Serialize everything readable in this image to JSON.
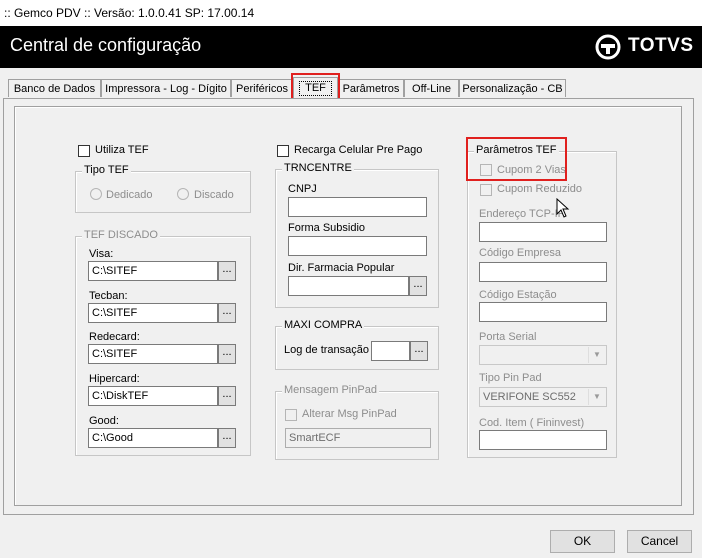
{
  "window": {
    "title": ":: Gemco PDV :: Versão: 1.0.0.41 SP: 17.00.14"
  },
  "header": {
    "title": "Central de configuração",
    "brand": "TOTVS"
  },
  "tabs": [
    {
      "label": "Banco de Dados"
    },
    {
      "label": "Impressora - Log - Dígito"
    },
    {
      "label": "Periféricos"
    },
    {
      "label": "TEF",
      "active": true
    },
    {
      "label": "Parâmetros"
    },
    {
      "label": "Off-Line"
    },
    {
      "label": "Personalização - CB"
    }
  ],
  "tef": {
    "utiliza_tef": "Utiliza TEF",
    "tipo_tef": {
      "legend": "Tipo TEF",
      "dedicado": "Dedicado",
      "discado": "Discado"
    },
    "tef_discado": {
      "legend": "TEF DISCADO",
      "fields": [
        {
          "label": "Visa:",
          "value": "C:\\SITEF"
        },
        {
          "label": "Tecban:",
          "value": "C:\\SITEF"
        },
        {
          "label": "Redecard:",
          "value": "C:\\SITEF"
        },
        {
          "label": "Hipercard:",
          "value": "C:\\DiskTEF"
        },
        {
          "label": "Good:",
          "value": "C:\\Good"
        }
      ],
      "browse_label": "..."
    }
  },
  "recarga": {
    "checkbox_label": "Recarga Celular Pre Pago",
    "trncentre": {
      "legend": "TRNCENTRE",
      "cnpj_label": "CNPJ",
      "cnpj_value": "",
      "forma_label": "Forma Subsidio",
      "forma_value": "",
      "dir_label": "Dir. Farmacia Popular",
      "dir_value": "",
      "browse_label": "..."
    },
    "maxi_compra": {
      "legend": "MAXI COMPRA",
      "log_label": "Log de transação",
      "log_value": "",
      "browse_label": "..."
    },
    "pinpad": {
      "legend": "Mensagem PinPad",
      "alterar_label": "Alterar Msg PinPad",
      "value": "SmartECF"
    }
  },
  "parametros_tef": {
    "legend": "Parâmetros TEF",
    "cupom_2_vias": "Cupom 2 Vias",
    "cupom_reduzido": "Cupom Reduzido",
    "endereco_label": "Endereço TCP-IP",
    "codigo_empresa_label": "Código Empresa",
    "codigo_estacao_label": "Código Estação",
    "porta_serial_label": "Porta Serial",
    "porta_serial_value": "",
    "tipo_pinpad_label": "Tipo Pin Pad",
    "tipo_pinpad_value": "VERIFONE SC552",
    "cod_item_label": "Cod. Item ( Fininvest)"
  },
  "buttons": {
    "ok": "OK",
    "cancel": "Cancel"
  },
  "colors": {
    "highlight": "#e0201e",
    "header_bg": "#000000"
  }
}
